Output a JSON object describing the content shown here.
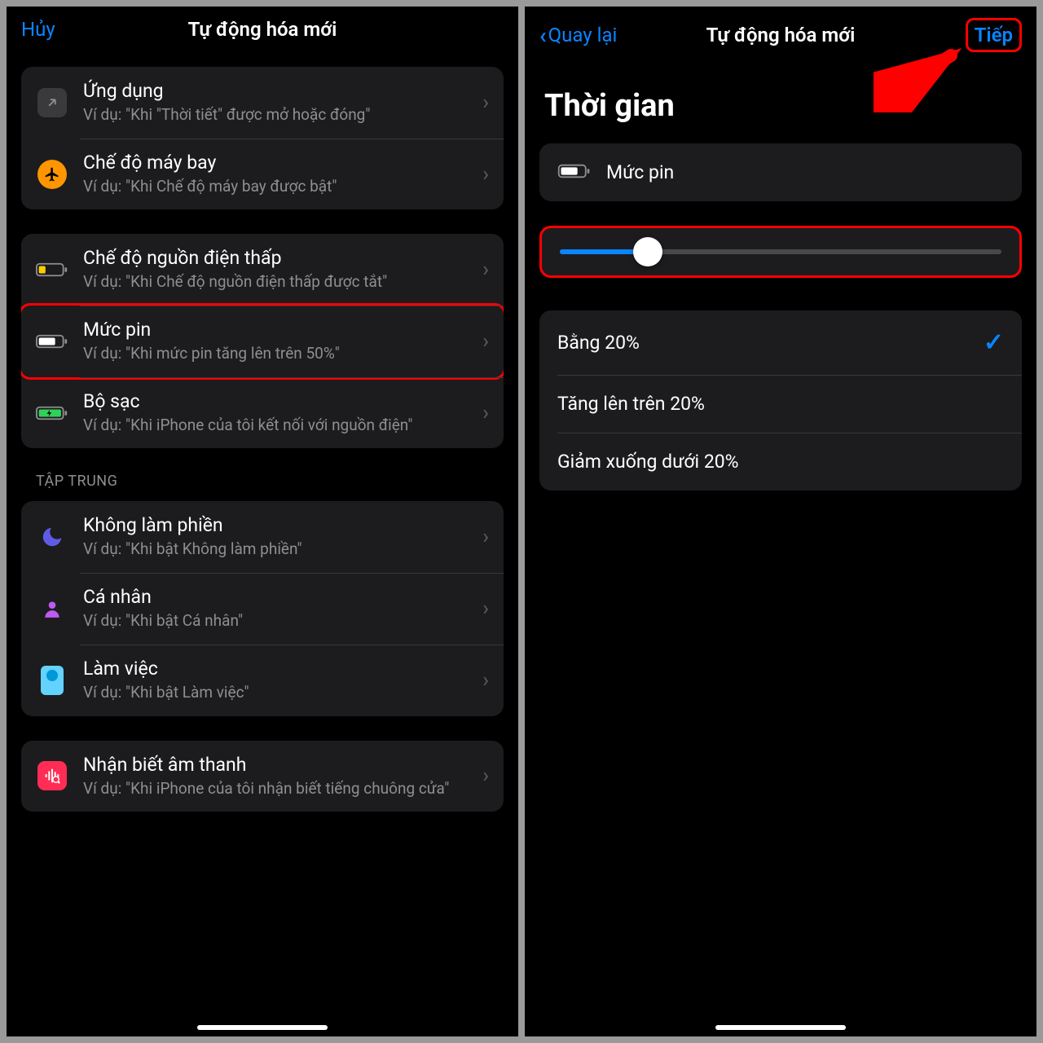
{
  "left": {
    "nav": {
      "cancel": "Hủy",
      "title": "Tự động hóa mới"
    },
    "group1": [
      {
        "title": "Ứng dụng",
        "subtitle": "Ví dụ: \"Khi \"Thời tiết\" được mở hoặc đóng\""
      },
      {
        "title": "Chế độ máy bay",
        "subtitle": "Ví dụ: \"Khi Chế độ máy bay được bật\""
      }
    ],
    "group2": [
      {
        "title": "Chế độ nguồn điện thấp",
        "subtitle": "Ví dụ: \"Khi Chế độ nguồn điện thấp được tắt\""
      },
      {
        "title": "Mức pin",
        "subtitle": "Ví dụ: \"Khi mức pin tăng lên trên 50%\""
      },
      {
        "title": "Bộ sạc",
        "subtitle": "Ví dụ: \"Khi iPhone của tôi kết nối với nguồn điện\""
      }
    ],
    "focus_header": "TẬP TRUNG",
    "group3": [
      {
        "title": "Không làm phiền",
        "subtitle": "Ví dụ: \"Khi bật Không làm phiền\""
      },
      {
        "title": "Cá nhân",
        "subtitle": "Ví dụ: \"Khi bật Cá nhân\""
      },
      {
        "title": "Làm việc",
        "subtitle": "Ví dụ: \"Khi bật Làm việc\""
      }
    ],
    "group4": [
      {
        "title": "Nhận biết âm thanh",
        "subtitle": "Ví dụ: \"Khi iPhone của tôi nhận biết tiếng chuông cửa\""
      }
    ]
  },
  "right": {
    "nav": {
      "back": "Quay lại",
      "title": "Tự động hóa mới",
      "next": "Tiếp"
    },
    "section_title": "Thời gian",
    "info_label": "Mức pin",
    "slider_percent": 20,
    "options": [
      {
        "label": "Bằng 20%",
        "selected": true
      },
      {
        "label": "Tăng lên trên 20%",
        "selected": false
      },
      {
        "label": "Giảm xuống dưới 20%",
        "selected": false
      }
    ]
  }
}
